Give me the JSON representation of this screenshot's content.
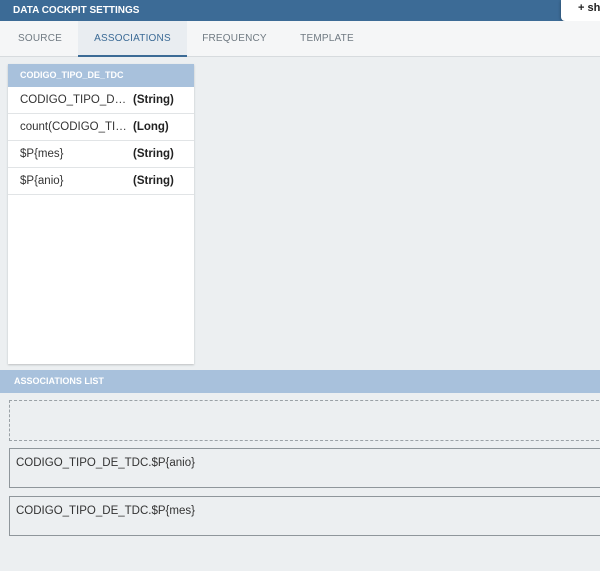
{
  "window": {
    "title": "DATA COCKPIT SETTINGS",
    "show_button_label": "+ sh"
  },
  "tabs": [
    {
      "label": "SOURCE",
      "active": false
    },
    {
      "label": "ASSOCIATIONS",
      "active": true
    },
    {
      "label": "FREQUENCY",
      "active": false
    },
    {
      "label": "TEMPLATE",
      "active": false
    }
  ],
  "dataset": {
    "name": "CODIGO_TIPO_DE_TDC",
    "fields": [
      {
        "name": "CODIGO_TIPO_DE_TDC",
        "type": "(String)"
      },
      {
        "name": "count(CODIGO_TIPO_DE_TDC)",
        "type": "(Long)"
      },
      {
        "name": "$P{mes}",
        "type": "(String)"
      },
      {
        "name": "$P{anio}",
        "type": "(String)"
      }
    ]
  },
  "associations": {
    "header": "ASSOCIATIONS LIST",
    "items": [
      {
        "label": "CODIGO_TIPO_DE_TDC.$P{anio}"
      },
      {
        "label": "CODIGO_TIPO_DE_TDC.$P{mes}"
      }
    ]
  },
  "colors": {
    "titlebar": "#3c6b96",
    "panel_header": "#a8c1dc",
    "background": "#eceff1",
    "active_tab": "#3c6b96"
  }
}
